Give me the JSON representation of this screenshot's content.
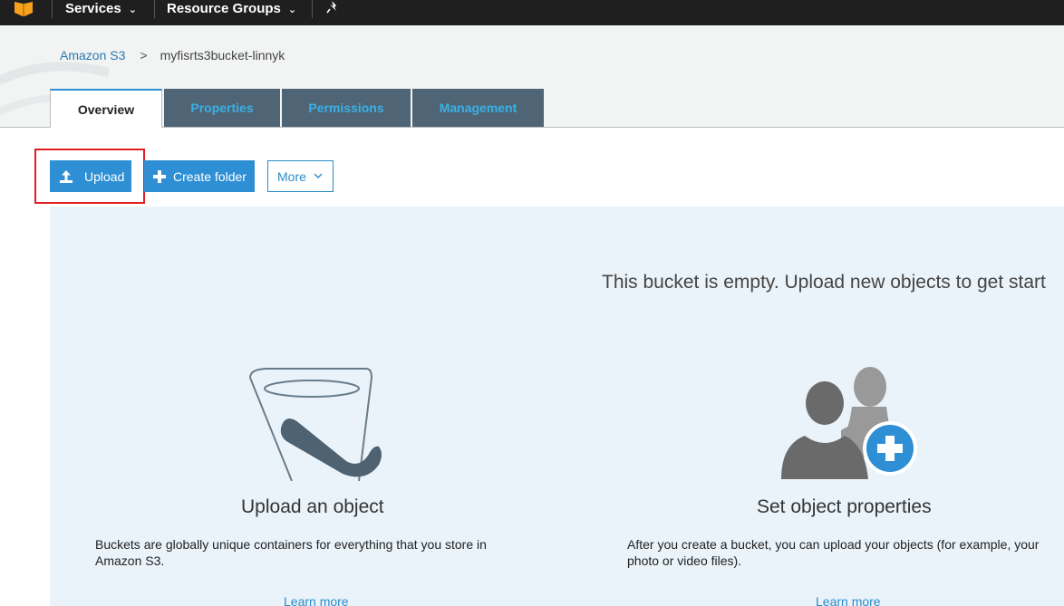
{
  "topnav": {
    "services_label": "Services",
    "resource_groups_label": "Resource Groups"
  },
  "breadcrumb": {
    "root": "Amazon S3",
    "separator": ">",
    "current": "myfisrts3bucket-linnyk"
  },
  "tabs": [
    {
      "label": "Overview",
      "active": true
    },
    {
      "label": "Properties",
      "active": false
    },
    {
      "label": "Permissions",
      "active": false
    },
    {
      "label": "Management",
      "active": false
    }
  ],
  "actions": {
    "upload_label": "Upload",
    "create_folder_label": "Create folder",
    "more_label": "More"
  },
  "empty_state": {
    "message": "This bucket is empty. Upload new objects to get start",
    "cards": [
      {
        "title": "Upload an object",
        "description_line1": "Buckets are globally unique containers for everything that you store in",
        "description_line2": "Amazon S3.",
        "link": "Learn more"
      },
      {
        "title": "Set object properties",
        "description_line1": "After you create a bucket, you can upload your objects (for example, your",
        "description_line2": "photo or video files).",
        "link": "Learn more"
      }
    ]
  },
  "colors": {
    "nav_bg": "#1f1f1f",
    "accent": "#2e8fd4",
    "tab_inactive_bg": "#4f6575",
    "tab_inactive_text": "#3ab0e6",
    "panel_bg": "#eaf3fa",
    "highlight": "#e02020"
  }
}
